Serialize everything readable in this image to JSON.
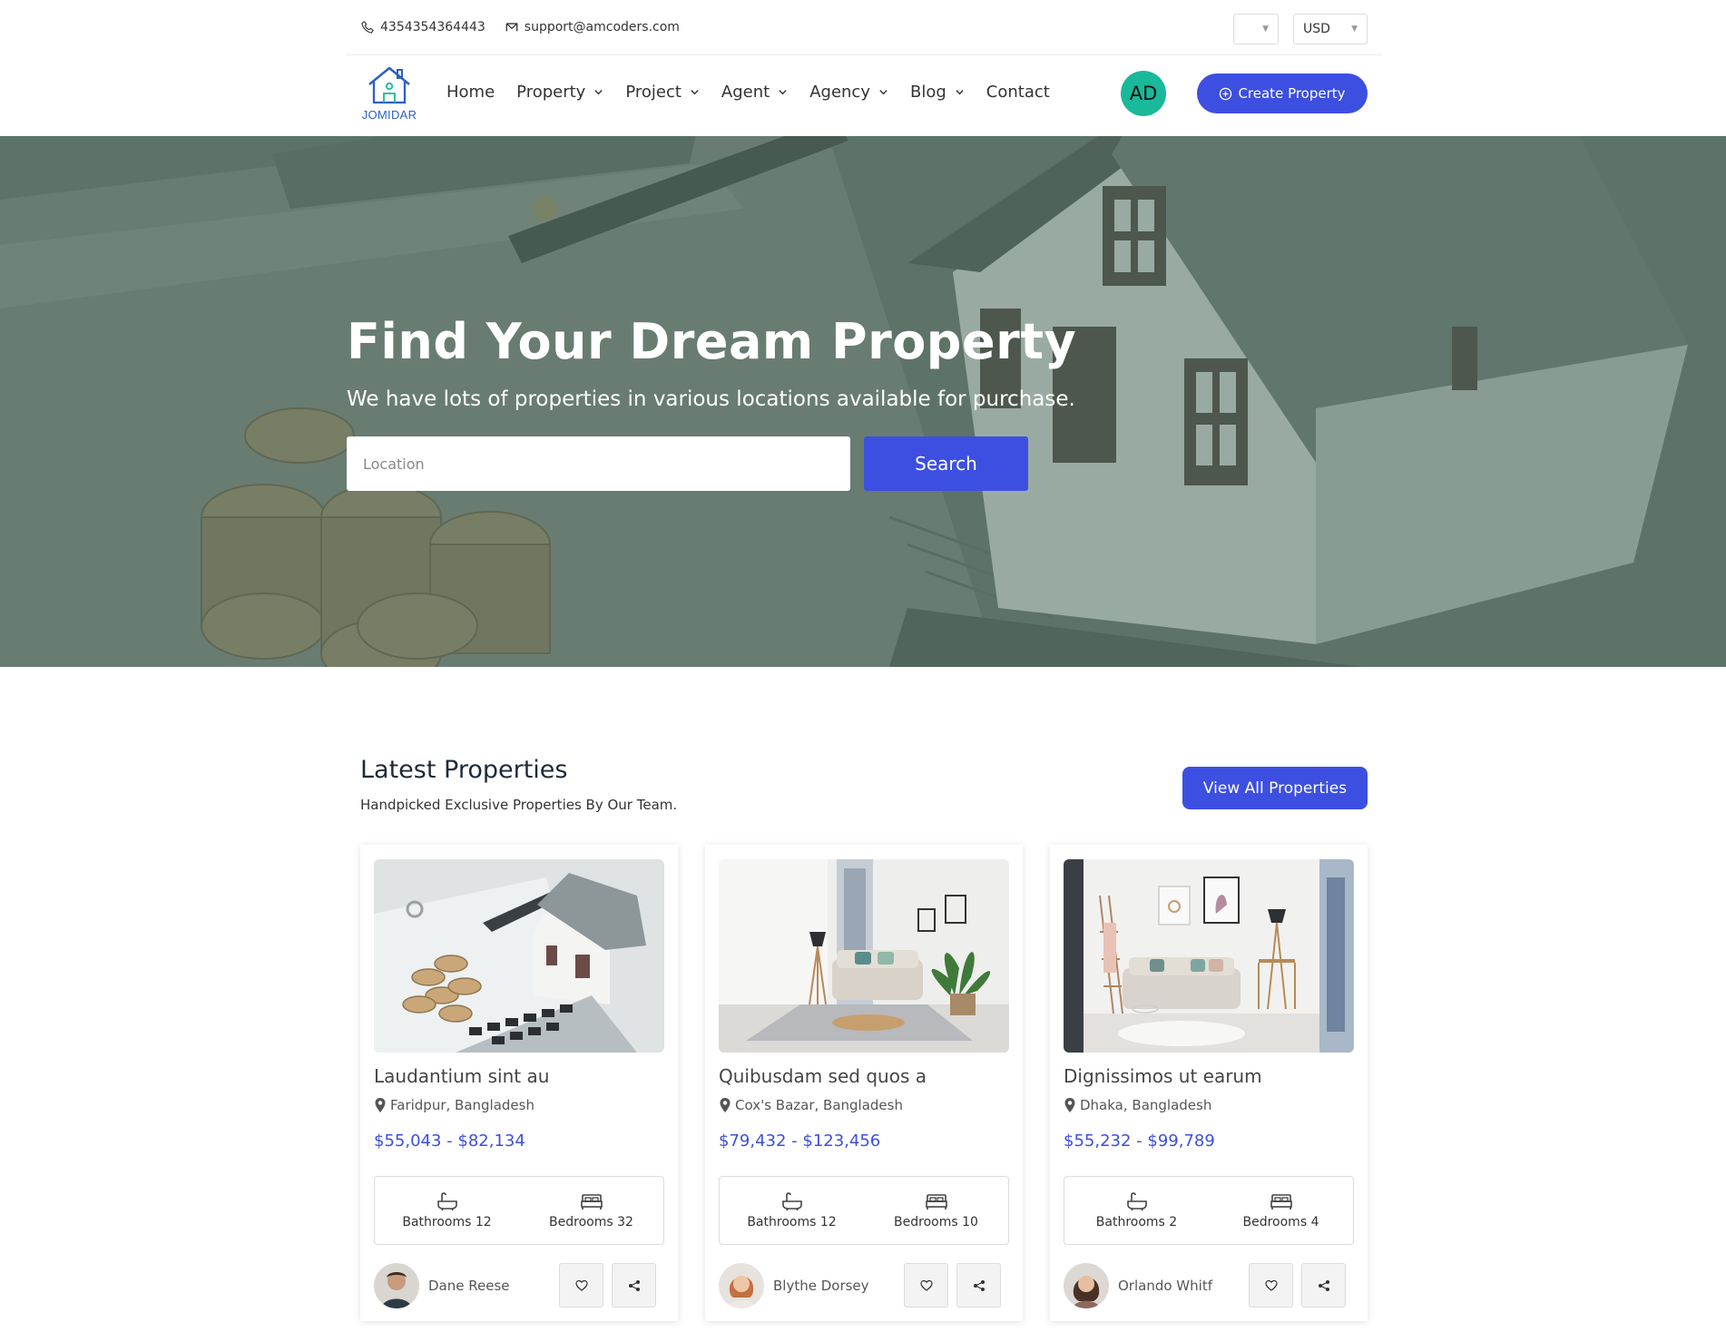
{
  "topbar": {
    "phone": "4354354364443",
    "email": "support@amcoders.com",
    "language_value": "",
    "currency_value": "USD"
  },
  "nav": {
    "logo_text": "JOMIDAR",
    "items": [
      {
        "label": "Home",
        "dropdown": false
      },
      {
        "label": "Property",
        "dropdown": true
      },
      {
        "label": "Project",
        "dropdown": true
      },
      {
        "label": "Agent",
        "dropdown": true
      },
      {
        "label": "Agency",
        "dropdown": true
      },
      {
        "label": "Blog",
        "dropdown": true
      },
      {
        "label": "Contact",
        "dropdown": false
      }
    ],
    "avatar_initials": "AD",
    "create_label": "Create Property"
  },
  "hero": {
    "title": "Find Your Dream Property",
    "subtitle": "We have lots of properties in various locations available for purchase.",
    "search_placeholder": "Location",
    "search_label": "Search"
  },
  "latest": {
    "title": "Latest Properties",
    "subtitle": "Handpicked Exclusive Properties By Our Team.",
    "view_all_label": "View All Properties",
    "cards": [
      {
        "title": "Laudantium sint au",
        "location": "Faridpur, Bangladesh",
        "price": "$55,043 - $82,134",
        "bathrooms": "Bathrooms 12",
        "bedrooms": "Bedrooms 32",
        "owner": "Dane Reese"
      },
      {
        "title": "Quibusdam sed quos a",
        "location": "Cox's Bazar, Bangladesh",
        "price": "$79,432 - $123,456",
        "bathrooms": "Bathrooms 12",
        "bedrooms": "Bedrooms 10",
        "owner": "Blythe Dorsey"
      },
      {
        "title": "Dignissimos ut earum",
        "location": "Dhaka, Bangladesh",
        "price": "$55,232 - $99,789",
        "bathrooms": "Bathrooms 2",
        "bedrooms": "Bedrooms 4",
        "owner": "Orlando Whitf"
      }
    ]
  },
  "colors": {
    "accent": "#3d4fe0",
    "avatar_bg": "#19b99a",
    "hero_tint": "#4f6a5e"
  },
  "icons": [
    "phone-icon",
    "mail-icon",
    "chevron-down-icon",
    "plus-circle-icon",
    "location-pin-icon",
    "bathtub-icon",
    "bed-icon",
    "heart-icon",
    "share-icon"
  ]
}
